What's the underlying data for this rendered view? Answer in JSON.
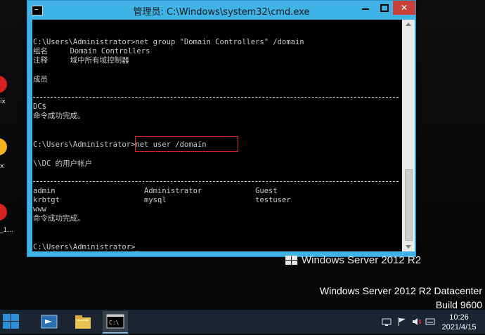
{
  "window": {
    "title": "管理员: C:\\Windows\\system32\\cmd.exe",
    "minimize_label": "",
    "maximize_label": "",
    "close_label": "✕"
  },
  "console": {
    "lines": [
      "C:\\Users\\Administrator>net group \"Domain Controllers\" /domain",
      "组名     Domain Controllers",
      "注释     域中所有域控制器",
      "成员",
      "DC$",
      "命令成功完成。",
      "C:\\Users\\Administrator>net user /domain",
      "\\\\DC 的用户帐户",
      "admin                    Administrator            Guest",
      "krbtgt                   mysql                    testuser",
      "www",
      "命令成功完成。",
      "C:\\Users\\Administrator>_"
    ]
  },
  "branding": {
    "product": "Windows Server 2012 R2",
    "edition": "Windows Server 2012 R2 Datacenter",
    "build": "Build 9600"
  },
  "desktop": {
    "icon_labels": [
      "ix",
      "x",
      "_1..."
    ]
  },
  "taskbar": {
    "clock_time": "10:26",
    "clock_date": "2021/4/15",
    "items": [
      "start-button",
      "server-manager",
      "file-explorer",
      "command-prompt"
    ]
  }
}
